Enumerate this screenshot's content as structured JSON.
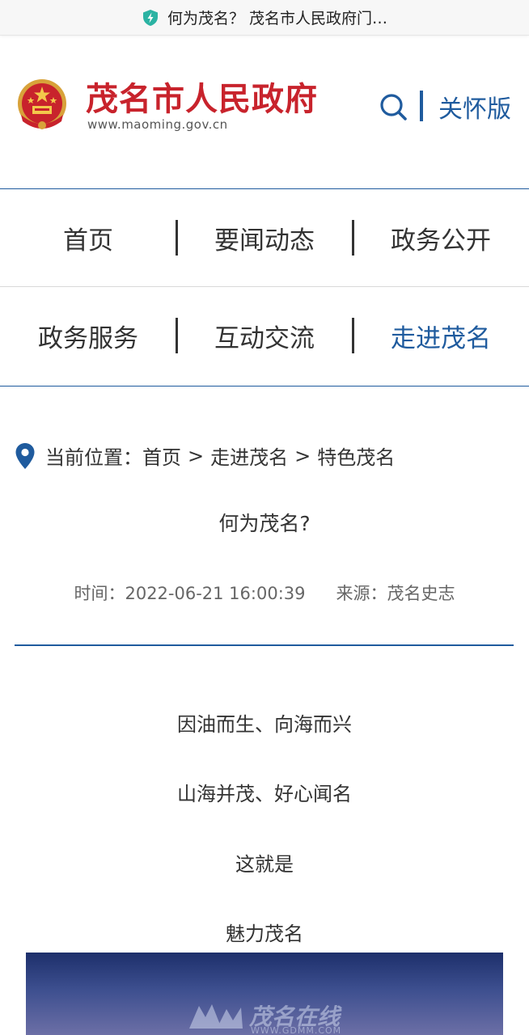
{
  "topbar": {
    "title": "何为茂名？  茂名市人民政府门…"
  },
  "header": {
    "site_name": "茂名市人民政府",
    "site_url": "www.maoming.gov.cn",
    "care_label": "关怀版"
  },
  "nav": {
    "row1": [
      "首页",
      "要闻动态",
      "政务公开"
    ],
    "row2": [
      "政务服务",
      "互动交流",
      "走进茂名"
    ],
    "active": "走进茂名"
  },
  "breadcrumb": {
    "prefix": "当前位置：",
    "items": [
      "首页",
      "走进茂名",
      "特色茂名"
    ],
    "separator": ">"
  },
  "article": {
    "title": "何为茂名?",
    "time_label": "时间：",
    "time": "2022-06-21 16:00:39",
    "source_label": "来源：",
    "source": "茂名史志",
    "paragraphs": [
      "因油而生、向海而兴",
      "山海并茂、好心闻名",
      "这就是",
      "魅力茂名"
    ]
  },
  "hero_watermark": {
    "title": "茂名在线",
    "url": "WWW.GDMM.COM"
  },
  "colors": {
    "brand_red": "#c8232c",
    "accent_blue": "#1f5b9e",
    "shield_green": "#2bb3a3"
  },
  "icons": [
    "shield-icon",
    "emblem-icon",
    "search-icon",
    "location-pin-icon",
    "watermark-logo-icon"
  ]
}
